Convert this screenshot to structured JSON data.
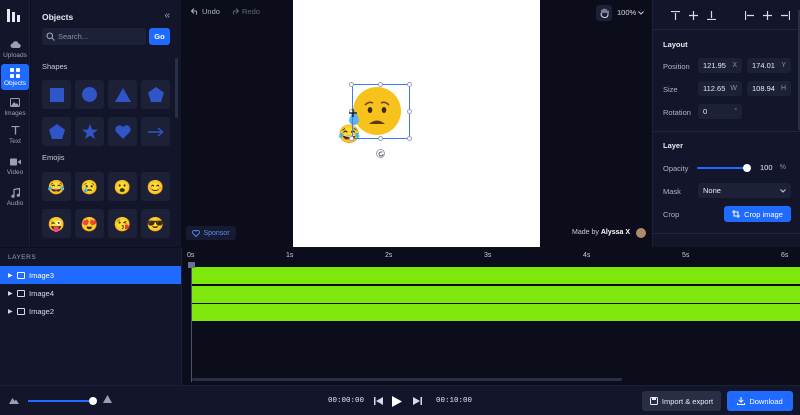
{
  "rail": {
    "items": [
      {
        "label": "Uploads",
        "icon": "cloud-upload-icon"
      },
      {
        "label": "Objects",
        "icon": "grid-icon"
      },
      {
        "label": "Images",
        "icon": "image-icon"
      },
      {
        "label": "Text",
        "icon": "text-icon"
      },
      {
        "label": "Video",
        "icon": "video-icon"
      },
      {
        "label": "Audio",
        "icon": "music-icon"
      }
    ],
    "active": "Objects"
  },
  "objects_panel": {
    "title": "Objects",
    "search_placeholder": "Search...",
    "go_label": "Go",
    "shapes_label": "Shapes",
    "emojis_label": "Emojis",
    "emojis": [
      "😂",
      "😢",
      "😮",
      "😊",
      "😜",
      "😍",
      "😘",
      "😎"
    ]
  },
  "toolbar": {
    "undo_label": "Undo",
    "redo_label": "Redo",
    "zoom": "100%"
  },
  "canvas": {
    "sponsor_label": "Sponsor",
    "made_by_prefix": "Made by",
    "made_by_name": "Alyssa X"
  },
  "properties": {
    "layout_title": "Layout",
    "position_label": "Position",
    "position_x": "121.95",
    "position_y": "174.01",
    "size_label": "Size",
    "size_w": "112.65",
    "size_h": "108.94",
    "rotation_label": "Rotation",
    "rotation": "0",
    "layer_title": "Layer",
    "opacity_label": "Opacity",
    "opacity": "100",
    "opacity_level": 1.0,
    "mask_label": "Mask",
    "mask_value": "None",
    "crop_label": "Crop",
    "crop_button": "Crop image",
    "suffix_x": "X",
    "suffix_y": "Y",
    "suffix_w": "W",
    "suffix_h": "H",
    "suffix_deg": "°",
    "suffix_pct": "%"
  },
  "layers": {
    "title": "LAYERS",
    "items": [
      {
        "name": "Image3",
        "active": true
      },
      {
        "name": "Image4",
        "active": false
      },
      {
        "name": "Image2",
        "active": false
      }
    ]
  },
  "timeline": {
    "ticks": [
      "0s",
      "1s",
      "2s",
      "3s",
      "4s",
      "5s",
      "6s"
    ],
    "track_color": "#7ee70b"
  },
  "bottombar": {
    "current_time": "00:00:00",
    "total_time": "00:10:00",
    "import_label": "Import & export",
    "download_label": "Download"
  },
  "colors": {
    "accent": "#1f6bff",
    "background": "#0d0f1c",
    "panel": "#13162a"
  }
}
